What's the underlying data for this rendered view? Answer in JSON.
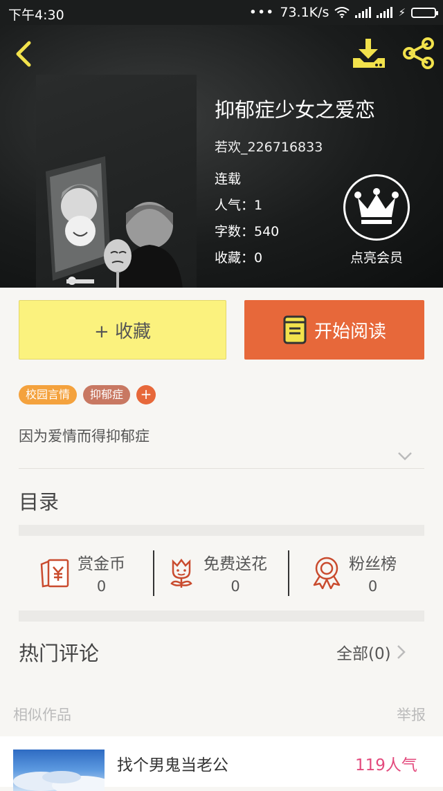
{
  "status_bar": {
    "time": "下午4:30",
    "dots": "•••",
    "net_speed": "73.1K/s",
    "charging_glyph": "⚡"
  },
  "icons": {
    "back": "chevron-left-icon",
    "download": "download-icon",
    "share": "share-icon",
    "vip": "crown-icon",
    "reading_book": "book-icon",
    "reward_coin": "red-envelope-icon",
    "free_flower": "flower-icon",
    "fans_rank": "medal-icon"
  },
  "colors": {
    "accent_orange": "#e7683a",
    "collect_yellow": "#fbf27e",
    "icon_yellow": "#f2e24c",
    "tag_school": "#f4a23d",
    "tag_depression": "#c87862",
    "popularity_pink": "#e34a7d"
  },
  "book": {
    "title": "抑郁症少女之爱恋",
    "author": "若欢_226716833",
    "status": "连载",
    "popularity": "人气：1",
    "word_count": "字数：540",
    "favorites": "收藏：0",
    "vip_label": "点亮会员",
    "description": "因为爱情而得抑郁症"
  },
  "actions": {
    "collect_label": "+ 收藏",
    "read_label": "开始阅读"
  },
  "tags": [
    {
      "label": "校园言情"
    },
    {
      "label": "抑郁症"
    }
  ],
  "tag_add_label": "+",
  "catalog_title": "目录",
  "rewards": [
    {
      "name": "赏金币",
      "count": "0"
    },
    {
      "name": "免费送花",
      "count": "0"
    },
    {
      "name": "粉丝榜",
      "count": "0"
    }
  ],
  "comments": {
    "title": "热门评论",
    "all_label": "全部(0)"
  },
  "similar": {
    "title": "相似作品",
    "report_label": "举报",
    "items": [
      {
        "title": "找个男鬼当老公",
        "popularity": "119人气"
      }
    ]
  }
}
